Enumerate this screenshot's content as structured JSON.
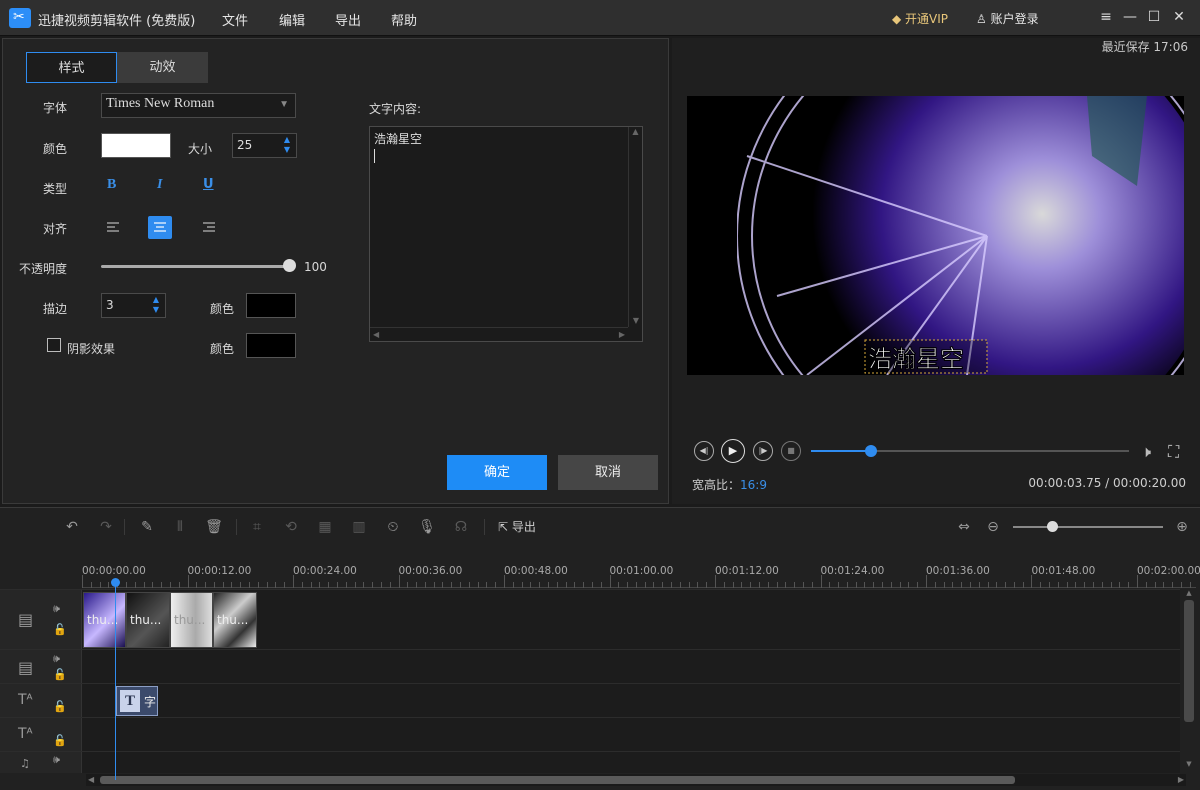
{
  "app": {
    "title": "迅捷视频剪辑软件 (免费版)"
  },
  "menu": {
    "file": "文件",
    "edit": "编辑",
    "export": "导出",
    "help": "帮助"
  },
  "header": {
    "vip": "开通VIP",
    "account": "账户登录"
  },
  "window": {
    "menu_icon": "≡",
    "min_icon": "—",
    "max_icon": "☐",
    "close_icon": "✕"
  },
  "editor": {
    "tabs": {
      "style": "样式",
      "animation": "动效"
    },
    "font_label": "字体",
    "font_value": "Times New Roman",
    "color_label": "颜色",
    "size_label": "大小",
    "size_value": "25",
    "type_label": "类型",
    "bold": "B",
    "italic": "I",
    "underline": "U",
    "align_label": "对齐",
    "opacity_label": "不透明度",
    "opacity_value": "100",
    "stroke_label": "描边",
    "stroke_value": "3",
    "stroke_color_label": "颜色",
    "shadow_label": "阴影效果",
    "shadow_color_label": "颜色",
    "text_content_label": "文字内容:",
    "text_content": "浩瀚星空",
    "confirm": "确定",
    "cancel": "取消"
  },
  "colors": {
    "accent": "#1e8cf6",
    "text_color": "#ffffff",
    "stroke_color": "#000000",
    "shadow_color": "#000000"
  },
  "preview": {
    "last_saved": "最近保存 17:06",
    "overlay_text": "浩瀚星空",
    "aspect_label": "宽高比：",
    "aspect_value": "16:9",
    "time": "00:00:03.75 / 00:00:20.00",
    "progress": 0.19
  },
  "toolbar": {
    "export_label": "导出"
  },
  "timeline": {
    "ticks": [
      "00:00:00.00",
      "00:00:12.00",
      "00:00:24.00",
      "00:00:36.00",
      "00:00:48.00",
      "00:01:00.00",
      "00:01:12.00",
      "00:01:24.00",
      "00:01:36.00",
      "00:01:48.00",
      "00:02:00.00"
    ],
    "clips": [
      "thu...",
      "thu...",
      "thu...",
      "thu..."
    ],
    "text_clip": "字"
  }
}
